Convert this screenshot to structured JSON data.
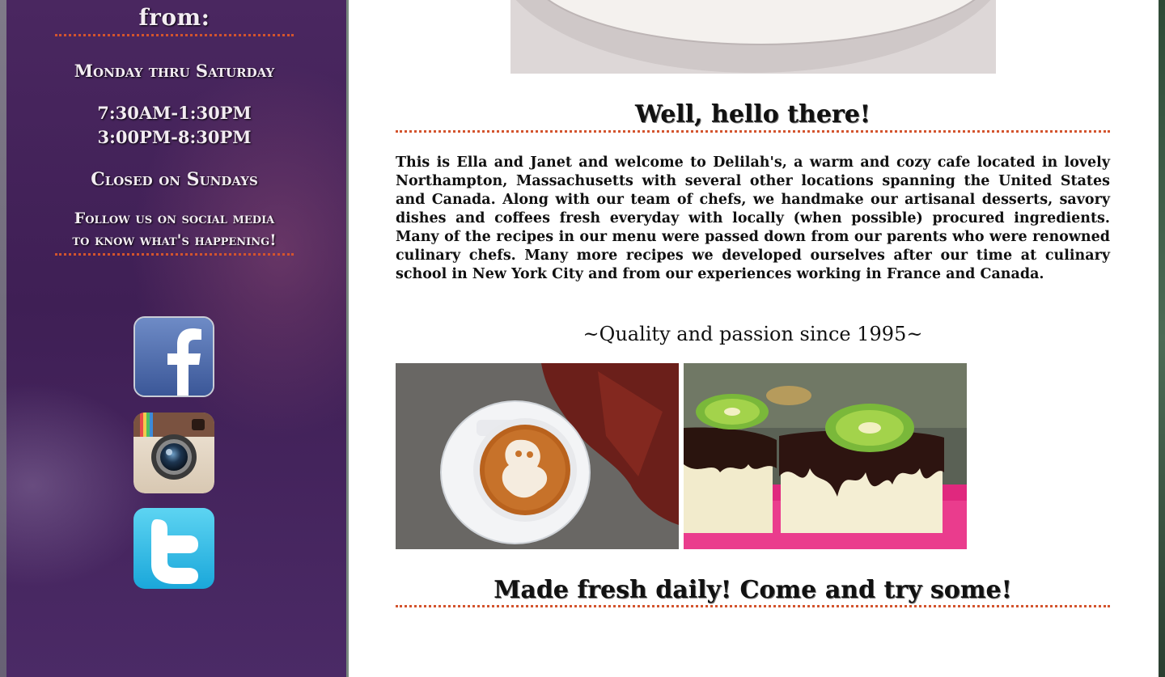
{
  "sidebar": {
    "title": "from:",
    "days": "Monday thru Saturday",
    "hours": [
      "7:30AM-1:30PM",
      "3:00PM-8:30PM"
    ],
    "closed": "Closed on Sundays",
    "follow": "Follow us on social media to know what's happening!",
    "social": [
      {
        "network": "Facebook",
        "icon": "facebook-icon"
      },
      {
        "network": "Instagram",
        "icon": "instagram-icon"
      },
      {
        "network": "Twitter",
        "icon": "twitter-icon"
      }
    ]
  },
  "main": {
    "hello_heading": "Well, hello there!",
    "intro": "This is Ella and Janet and welcome to Delilah's, a warm and cozy cafe located in lovely Northampton, Massachusetts with several other locations spanning the United States and Canada. Along with our team of chefs, we handmake our artisanal desserts, savory dishes and coffees fresh everyday with locally (when possible) procured ingredients. Many of the recipes in our menu were passed down from our parents who were renowned culinary chefs. Many more recipes we developed ourselves after our time at culinary school in New York City and from our experiences working in France and Canada.",
    "tagline": "~Quality and passion since 1995~",
    "photos": [
      "latte-art-photo",
      "chocolate-kiwi-cake-photo"
    ],
    "fresh_heading": "Made fresh daily! Come and try some!"
  },
  "colors": {
    "sidebar_bg": "#4a2760",
    "rule": "#d3542d",
    "sidebar_text": "#f3ecf2",
    "main_text": "#111111"
  }
}
